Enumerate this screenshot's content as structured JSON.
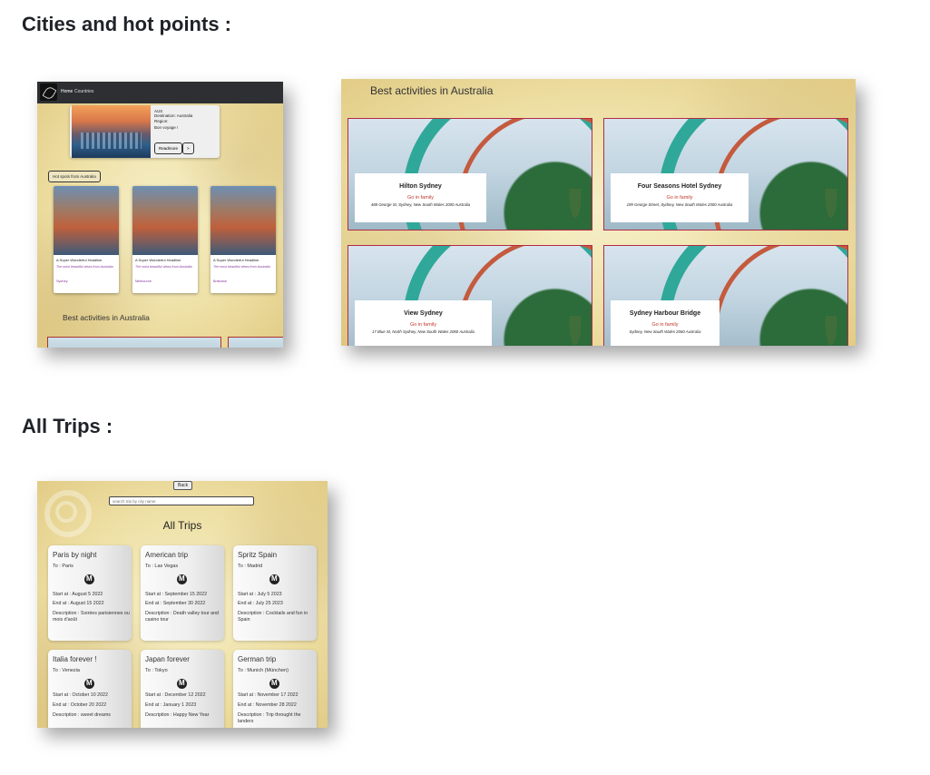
{
  "sections": {
    "cities_title": "Cities and hot points :",
    "trips_title": "All Trips :"
  },
  "shot1": {
    "nav": [
      "Home",
      "Countries"
    ],
    "city": {
      "code": "AUS",
      "destination": "Destination: Australia",
      "region": "Region:",
      "voyage": "Bon voyage !",
      "readmore": "Readmore",
      "arrow": ">"
    },
    "hot_button": "Hot spots from Australia",
    "hot_cards": [
      {
        "title": "A Super Wonderful Headline",
        "desc": "The most beautiful views from Australia",
        "city": "Sydney"
      },
      {
        "title": "A Super Wonderful Headline",
        "desc": "The most beautiful views from Australia",
        "city": "Melbourne"
      },
      {
        "title": "A Super Wonderful Headline",
        "desc": "The most beautiful views from Australia",
        "city": "Brisbane"
      }
    ],
    "best": "Best activities in Australia"
  },
  "shot2": {
    "best": "Best activities in Australia",
    "activities": [
      {
        "name": "Hilton Sydney",
        "fam": "Go in family",
        "addr": "488 George St, Sydney, New South Wales 2000 Australia"
      },
      {
        "name": "Four Seasons Hotel Sydney",
        "fam": "Go in family",
        "addr": "199 George Street, Sydney, New South Wales 2000 Australia"
      },
      {
        "name": "View Sydney",
        "fam": "Go in family",
        "addr": "17 Blue St, North Sydney, New South Wales 2060 Australia"
      },
      {
        "name": "Sydney Harbour Bridge",
        "fam": "Go in family",
        "addr": "Sydney, New South Wales 2060 Australia"
      }
    ]
  },
  "shot3": {
    "back": "Back",
    "search_placeholder": "search trip by city name",
    "title": "All Trips",
    "trips": [
      {
        "name": "Paris by night",
        "to": "To : Paris",
        "start": "Start at : August 5 2022",
        "end": "End at : August 15 2022",
        "desc": "Description : Soirées parisiennes ou mois d'août"
      },
      {
        "name": "American trip",
        "to": "To : Las Vegas",
        "start": "Start at : September 15 2022",
        "end": "End at : September 30 2022",
        "desc": "Description : Death valley tour and casino tour"
      },
      {
        "name": "Spritz Spain",
        "to": "To : Madrid",
        "start": "Start at : July 5 2023",
        "end": "End at : July 25 2023",
        "desc": "Description : Cocktails and fun in Spain"
      },
      {
        "name": "Italia forever !",
        "to": "To : Venezia",
        "start": "Start at : October 10 2022",
        "end": "End at : October 20 2022",
        "desc": "Description : sweet dreams"
      },
      {
        "name": "Japan forever",
        "to": "To : Tokyo",
        "start": "Start at : December 12 2022",
        "end": "End at : January 1 2023",
        "desc": "Description : Happy New Year"
      },
      {
        "name": "German trip",
        "to": "To : Munich (München)",
        "start": "Start at : November 17 2022",
        "end": "End at : November 28 2022",
        "desc": "Description : Trip throught the landers"
      }
    ]
  }
}
